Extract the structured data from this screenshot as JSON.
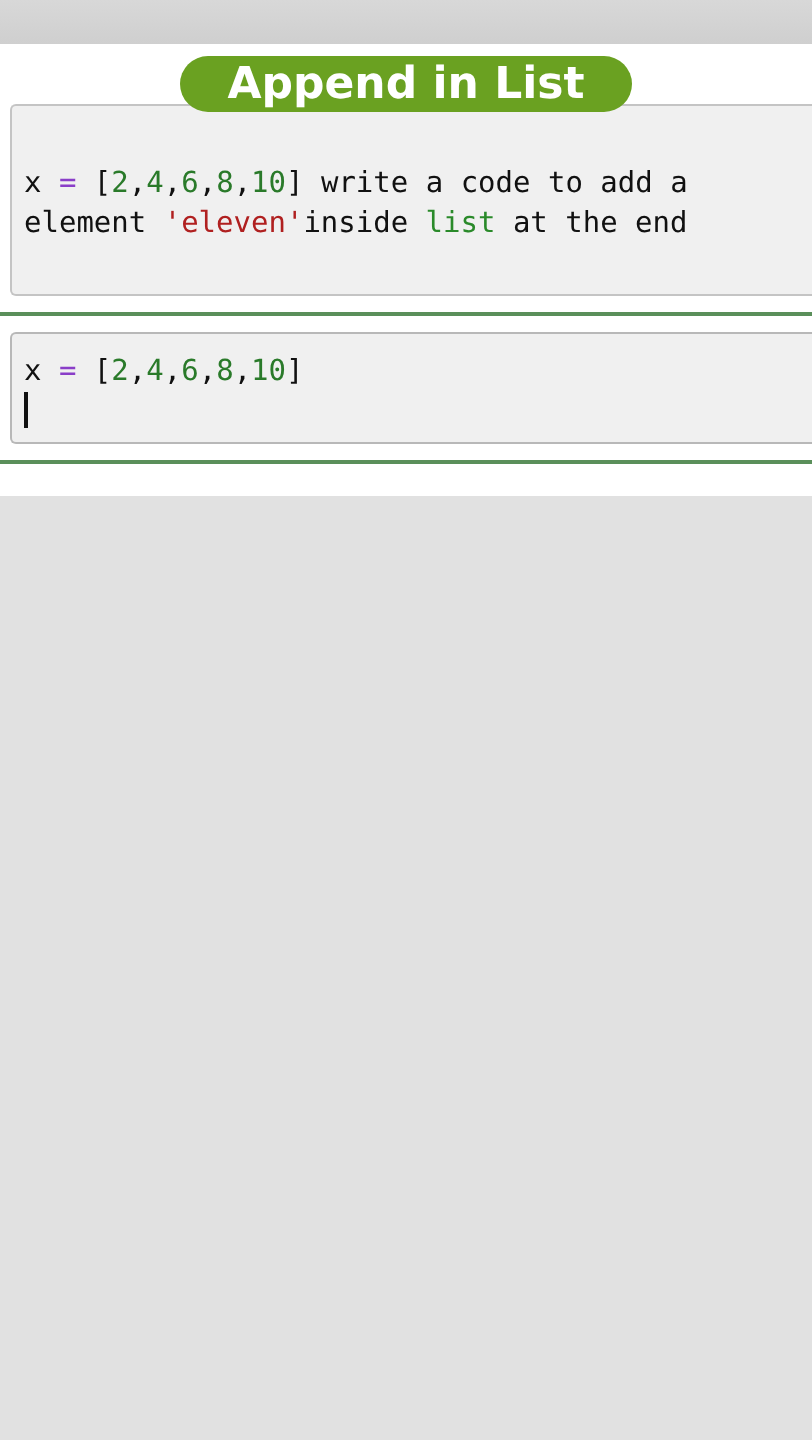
{
  "title": "Append in List",
  "cells": [
    {
      "selected": false,
      "cursor": false,
      "lines": [
        [
          {
            "text": "x ",
            "kind": "name"
          },
          {
            "text": "=",
            "kind": "op"
          },
          {
            "text": " [",
            "kind": "name"
          },
          {
            "text": "2",
            "kind": "num"
          },
          {
            "text": ",",
            "kind": "name"
          },
          {
            "text": "4",
            "kind": "num"
          },
          {
            "text": ",",
            "kind": "name"
          },
          {
            "text": "6",
            "kind": "num"
          },
          {
            "text": ",",
            "kind": "name"
          },
          {
            "text": "8",
            "kind": "num"
          },
          {
            "text": ",",
            "kind": "name"
          },
          {
            "text": "10",
            "kind": "num"
          },
          {
            "text": "] write a code to add a",
            "kind": "name"
          }
        ],
        [
          {
            "text": "element ",
            "kind": "name"
          },
          {
            "text": "'eleven'",
            "kind": "str"
          },
          {
            "text": "inside ",
            "kind": "name"
          },
          {
            "text": "list",
            "kind": "builtin"
          },
          {
            "text": " at the end",
            "kind": "name"
          }
        ]
      ]
    },
    {
      "selected": true,
      "cursor": true,
      "lines": [
        [
          {
            "text": "x ",
            "kind": "name"
          },
          {
            "text": "=",
            "kind": "op"
          },
          {
            "text": " [",
            "kind": "name"
          },
          {
            "text": "2",
            "kind": "num"
          },
          {
            "text": ",",
            "kind": "name"
          },
          {
            "text": "4",
            "kind": "num"
          },
          {
            "text": ",",
            "kind": "name"
          },
          {
            "text": "6",
            "kind": "num"
          },
          {
            "text": ",",
            "kind": "name"
          },
          {
            "text": "8",
            "kind": "num"
          },
          {
            "text": ",",
            "kind": "name"
          },
          {
            "text": "10",
            "kind": "num"
          },
          {
            "text": "]",
            "kind": "name"
          }
        ]
      ]
    }
  ]
}
